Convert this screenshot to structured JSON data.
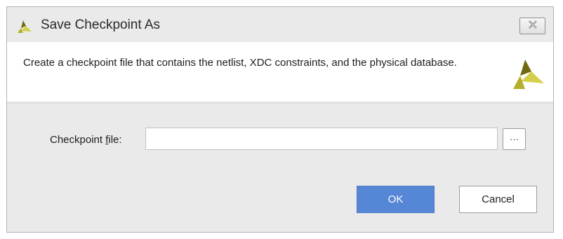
{
  "window": {
    "title": "Save Checkpoint As",
    "logo_icon": "vivado-logo-icon",
    "close_icon": "close-icon"
  },
  "banner": {
    "description": "Create a checkpoint file that contains the netlist, XDC constraints, and the physical database.",
    "logo_icon": "vivado-logo-icon"
  },
  "form": {
    "checkpoint_label_prefix": "Checkpoint ",
    "checkpoint_label_mnemonic": "f",
    "checkpoint_label_suffix": "ile:",
    "checkpoint_value": "",
    "browse_label": "···"
  },
  "buttons": {
    "ok_label": "OK",
    "cancel_label": "Cancel"
  },
  "colors": {
    "accent": "#5686d6",
    "logo_dark": "#6f6a12",
    "logo_light": "#d4cf4a"
  }
}
